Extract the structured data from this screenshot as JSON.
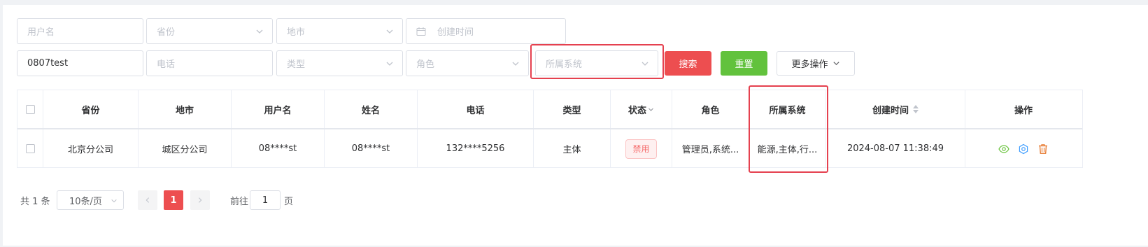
{
  "filters": {
    "username_placeholder": "用户名",
    "province_placeholder": "省份",
    "city_placeholder": "地市",
    "created_time_placeholder": "创建时间",
    "search_value": "0807test",
    "phone_placeholder": "电话",
    "type_placeholder": "类型",
    "role_placeholder": "角色",
    "system_placeholder": "所属系统"
  },
  "buttons": {
    "search": "搜索",
    "reset": "重置",
    "more": "更多操作"
  },
  "table": {
    "columns": [
      "省份",
      "地市",
      "用户名",
      "姓名",
      "电话",
      "类型",
      "状态",
      "角色",
      "所属系统",
      "创建时间",
      "操作"
    ],
    "rows": [
      {
        "province": "北京分公司",
        "city": "城区分公司",
        "username": "08****st",
        "name": "08****st",
        "phone": "132****5256",
        "type": "主体",
        "status": "禁用",
        "role": "管理员,系统...",
        "system": "能源,主体,行...",
        "created": "2024-08-07 11:38:49"
      }
    ]
  },
  "pagination": {
    "total_text": "共 1 条",
    "page_size": "10条/页",
    "current_page": "1",
    "goto_label": "前往",
    "goto_value": "1",
    "goto_suffix": "页"
  },
  "colors": {
    "primary_red": "#ed4e50",
    "reset_green": "#62c23d",
    "highlight": "#e5414f",
    "view_icon": "#67c23a",
    "settings_icon": "#409eff",
    "delete_icon": "#e6762a"
  },
  "icons": {
    "view": "eye-icon",
    "settings": "gear-icon",
    "delete": "trash-icon"
  }
}
